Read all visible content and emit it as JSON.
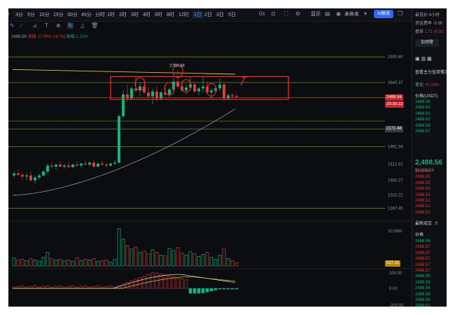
{
  "toolbar": {
    "timeframes": [
      "3分",
      "5分",
      "10分",
      "15分",
      "30分",
      "45分",
      "分时",
      "1时",
      "2时",
      "3时",
      "4时",
      "6时",
      "8时",
      "12时",
      "1日",
      "2日",
      "3日",
      "5日"
    ],
    "active_timeframe": "1日",
    "right_labels": [
      "0s",
      "显示",
      "未命名"
    ],
    "ai_label": "AI解读"
  },
  "info_line": {
    "price": "2488.56",
    "change_label": "涨幅 -0.79%",
    "change_value": "(-19.76)",
    "amplitude": "振幅 1.21%"
  },
  "price_axis": [
    "2900.60",
    "2640.37",
    "2171.48",
    "1991.59",
    "1812.91",
    "1650.27",
    "1502.22",
    "1367.45"
  ],
  "price_tags": {
    "current": "2488.56",
    "countdown": "20:30:22",
    "crosshair": "2171.48"
  },
  "annotation": {
    "high_label": "2768.88"
  },
  "volume": {
    "axis_label": "10.00M",
    "tag": "527.1k"
  },
  "macd": {
    "axis": [
      "200.00",
      "0.00",
      "-200.00"
    ]
  },
  "sidebar": {
    "rows": [
      {
        "label": "最低价",
        "value": "4小时"
      },
      {
        "label": "资金费率",
        "value": "-0.00"
      },
      {
        "label": "基差",
        "value": "1.71 (0.00"
      }
    ],
    "button": "加预警",
    "section_title": "查看主力挂单情况",
    "change_label": "变化",
    "change_value": "+0.10%",
    "price_header": "价格(USDT)",
    "ask_prices": [
      "2488.56",
      "2488.63",
      "2488.63",
      "2488.62",
      "2488.58",
      "2488.57"
    ],
    "last_price": "2,488.56",
    "last_sub": "$2,488.56",
    "bid_prices": [
      "2488.56",
      "2488.55",
      "2488.55",
      "2488.54",
      "2488.53",
      "2488.52",
      "2488.51",
      "2488.51"
    ],
    "trades_title": "最新成交",
    "trades_tab2": "大",
    "trades_header": "价格",
    "trades_prices": [
      "2488.56",
      "2488.57",
      "2488.57",
      "2488.57",
      "2488.57",
      "2488.57",
      "2488.56",
      "2488.56",
      "2488.56",
      "2488.56",
      "2488.56",
      "2488.61"
    ],
    "trades_colors": [
      "g",
      "r",
      "r",
      "r",
      "r",
      "r",
      "g",
      "g",
      "g",
      "g",
      "g",
      "g"
    ]
  },
  "colors": {
    "up": "#14b37d",
    "down": "#e03a3a",
    "accent": "#3366ff",
    "ma_yellow": "#d8c24a",
    "ma_grey": "#8f959c",
    "annotation_red": "#ff2b2b"
  },
  "chart_data": {
    "type": "candlestick",
    "title": "",
    "ylim": [
      1280,
      3050
    ],
    "candles": [
      {
        "o": 1700,
        "h": 1740,
        "l": 1680,
        "c": 1720,
        "v": 1.2
      },
      {
        "o": 1720,
        "h": 1760,
        "l": 1700,
        "c": 1705,
        "v": 0.9
      },
      {
        "o": 1705,
        "h": 1730,
        "l": 1660,
        "c": 1690,
        "v": 1.0
      },
      {
        "o": 1690,
        "h": 1720,
        "l": 1650,
        "c": 1700,
        "v": 0.8
      },
      {
        "o": 1700,
        "h": 1740,
        "l": 1640,
        "c": 1650,
        "v": 1.1
      },
      {
        "o": 1650,
        "h": 1700,
        "l": 1620,
        "c": 1680,
        "v": 0.9
      },
      {
        "o": 1680,
        "h": 1720,
        "l": 1660,
        "c": 1700,
        "v": 0.7
      },
      {
        "o": 1700,
        "h": 1750,
        "l": 1690,
        "c": 1740,
        "v": 1.3
      },
      {
        "o": 1740,
        "h": 1820,
        "l": 1720,
        "c": 1800,
        "v": 2.0
      },
      {
        "o": 1800,
        "h": 1830,
        "l": 1770,
        "c": 1790,
        "v": 1.1
      },
      {
        "o": 1790,
        "h": 1820,
        "l": 1760,
        "c": 1810,
        "v": 0.9
      },
      {
        "o": 1810,
        "h": 1840,
        "l": 1780,
        "c": 1790,
        "v": 1.0
      },
      {
        "o": 1790,
        "h": 1820,
        "l": 1770,
        "c": 1800,
        "v": 0.8
      },
      {
        "o": 1800,
        "h": 1830,
        "l": 1780,
        "c": 1785,
        "v": 0.9
      },
      {
        "o": 1785,
        "h": 1820,
        "l": 1770,
        "c": 1810,
        "v": 0.7
      },
      {
        "o": 1810,
        "h": 1840,
        "l": 1790,
        "c": 1800,
        "v": 1.2
      },
      {
        "o": 1800,
        "h": 1830,
        "l": 1780,
        "c": 1820,
        "v": 0.8
      },
      {
        "o": 1820,
        "h": 1850,
        "l": 1800,
        "c": 1810,
        "v": 1.0
      },
      {
        "o": 1810,
        "h": 1840,
        "l": 1790,
        "c": 1830,
        "v": 0.9
      },
      {
        "o": 1830,
        "h": 1850,
        "l": 1780,
        "c": 1790,
        "v": 1.1
      },
      {
        "o": 1790,
        "h": 1830,
        "l": 1780,
        "c": 1820,
        "v": 0.7
      },
      {
        "o": 1820,
        "h": 1850,
        "l": 1800,
        "c": 1810,
        "v": 0.8
      },
      {
        "o": 1810,
        "h": 1830,
        "l": 1780,
        "c": 1800,
        "v": 0.9
      },
      {
        "o": 1800,
        "h": 1830,
        "l": 1790,
        "c": 1820,
        "v": 0.6
      },
      {
        "o": 1820,
        "h": 1860,
        "l": 1800,
        "c": 1830,
        "v": 1.0
      },
      {
        "o": 1830,
        "h": 2320,
        "l": 1820,
        "c": 2300,
        "v": 5.5
      },
      {
        "o": 2300,
        "h": 2560,
        "l": 2280,
        "c": 2520,
        "v": 4.0
      },
      {
        "o": 2520,
        "h": 2620,
        "l": 2440,
        "c": 2480,
        "v": 3.0
      },
      {
        "o": 2480,
        "h": 2600,
        "l": 2460,
        "c": 2580,
        "v": 2.5
      },
      {
        "o": 2580,
        "h": 2700,
        "l": 2540,
        "c": 2560,
        "v": 2.8
      },
      {
        "o": 2560,
        "h": 2640,
        "l": 2500,
        "c": 2600,
        "v": 2.0
      },
      {
        "o": 2600,
        "h": 2680,
        "l": 2520,
        "c": 2540,
        "v": 2.2
      },
      {
        "o": 2540,
        "h": 2600,
        "l": 2480,
        "c": 2500,
        "v": 1.8
      },
      {
        "o": 2500,
        "h": 2580,
        "l": 2420,
        "c": 2550,
        "v": 2.4
      },
      {
        "o": 2550,
        "h": 2600,
        "l": 2450,
        "c": 2480,
        "v": 2.0
      },
      {
        "o": 2480,
        "h": 2560,
        "l": 2460,
        "c": 2540,
        "v": 1.6
      },
      {
        "o": 2540,
        "h": 2620,
        "l": 2500,
        "c": 2520,
        "v": 1.5
      },
      {
        "o": 2520,
        "h": 2590,
        "l": 2490,
        "c": 2570,
        "v": 2.6
      },
      {
        "o": 2570,
        "h": 2690,
        "l": 2540,
        "c": 2650,
        "v": 2.3
      },
      {
        "o": 2650,
        "h": 2769,
        "l": 2580,
        "c": 2600,
        "v": 2.7
      },
      {
        "o": 2600,
        "h": 2660,
        "l": 2540,
        "c": 2560,
        "v": 1.9
      },
      {
        "o": 2560,
        "h": 2620,
        "l": 2520,
        "c": 2590,
        "v": 1.6
      },
      {
        "o": 2590,
        "h": 2700,
        "l": 2560,
        "c": 2620,
        "v": 2.1
      },
      {
        "o": 2620,
        "h": 2650,
        "l": 2530,
        "c": 2550,
        "v": 1.8
      },
      {
        "o": 2550,
        "h": 2600,
        "l": 2510,
        "c": 2580,
        "v": 1.4
      },
      {
        "o": 2580,
        "h": 2700,
        "l": 2540,
        "c": 2600,
        "v": 1.7
      },
      {
        "o": 2600,
        "h": 2650,
        "l": 2520,
        "c": 2540,
        "v": 2.0
      },
      {
        "o": 2540,
        "h": 2580,
        "l": 2470,
        "c": 2560,
        "v": 1.3
      },
      {
        "o": 2560,
        "h": 2600,
        "l": 2540,
        "c": 2580,
        "v": 1.0
      },
      {
        "o": 2580,
        "h": 2680,
        "l": 2550,
        "c": 2620,
        "v": 1.6
      },
      {
        "o": 2620,
        "h": 2640,
        "l": 2450,
        "c": 2480,
        "v": 2.5
      },
      {
        "o": 2480,
        "h": 2530,
        "l": 2460,
        "c": 2510,
        "v": 1.1
      },
      {
        "o": 2510,
        "h": 2530,
        "l": 2480,
        "c": 2500,
        "v": 0.8
      },
      {
        "o": 2500,
        "h": 2520,
        "l": 2480,
        "c": 2488,
        "v": 0.5
      }
    ],
    "hlines": [
      2900,
      2640,
      2488,
      2250,
      2171,
      1991,
      1367
    ],
    "box": {
      "y_top": 2700,
      "y_bottom": 2470,
      "from_index": 24,
      "to_index": 53
    },
    "circled_highs_index": [
      30,
      37,
      39,
      41,
      47
    ]
  }
}
